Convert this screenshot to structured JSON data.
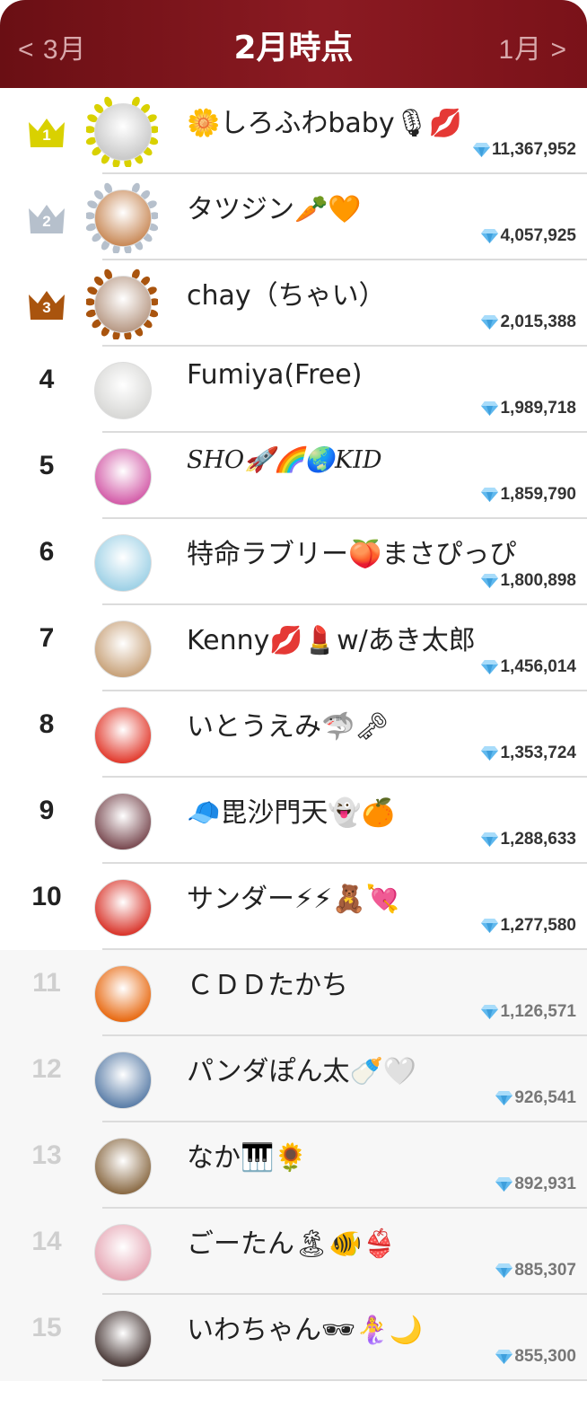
{
  "header": {
    "prev_label": "< 3月",
    "title": "2月時点",
    "next_label": "1月 >",
    "bg_color": "#7a1219"
  },
  "colors": {
    "gold": "#d9d100",
    "silver": "#b6c0cc",
    "bronze": "#a9540e"
  },
  "ranking": [
    {
      "rank": "1",
      "name": "🌼しろふわbaby🎙💋",
      "score": "11,367,952",
      "crown": "gold",
      "avatar_color": "#c9c9c9"
    },
    {
      "rank": "2",
      "name": "タツジン🥕🧡",
      "score": "4,057,925",
      "crown": "silver",
      "avatar_color": "#c98a58"
    },
    {
      "rank": "3",
      "name": "chay（ちゃい）",
      "score": "2,015,388",
      "crown": "bronze",
      "avatar_color": "#b89a86"
    },
    {
      "rank": "4",
      "name": "Fumiya(Free)",
      "score": "1,989,718",
      "crown": "",
      "avatar_color": "#d8d8d6"
    },
    {
      "rank": "5",
      "name": "SHO🚀🌈🌏KID",
      "score": "1,859,790",
      "crown": "",
      "avatar_color": "#d35ca8",
      "style": "serif-italic"
    },
    {
      "rank": "6",
      "name": "特命ラブリー🍑まさぴっぴ",
      "score": "1,800,898",
      "crown": "",
      "avatar_color": "#9ed1e6"
    },
    {
      "rank": "7",
      "name": "Kenny💋💄w/あき太郎",
      "score": "1,456,014",
      "crown": "",
      "avatar_color": "#c8a27a"
    },
    {
      "rank": "8",
      "name": "いとうえみ🦈🗝",
      "score": "1,353,724",
      "crown": "",
      "avatar_color": "#e23b2e"
    },
    {
      "rank": "9",
      "name": "🧢毘沙門天👻🍊",
      "score": "1,288,633",
      "crown": "",
      "avatar_color": "#7a4b52"
    },
    {
      "rank": "10",
      "name": "サンダー⚡⚡🧸💘",
      "score": "1,277,580",
      "crown": "",
      "avatar_color": "#d9352b"
    },
    {
      "rank": "11",
      "name": "ＣＤＤたかち",
      "score": "1,126,571",
      "crown": "",
      "avatar_color": "#e86a12"
    },
    {
      "rank": "12",
      "name": "パンダぽん太🍼🤍",
      "score": "926,541",
      "crown": "",
      "avatar_color": "#5b7ea8"
    },
    {
      "rank": "13",
      "name": "なか🎹🌻",
      "score": "892,931",
      "crown": "",
      "avatar_color": "#8a6a44"
    },
    {
      "rank": "14",
      "name": "ごーたん🏝🐠👙",
      "score": "885,307",
      "crown": "",
      "avatar_color": "#e6a6b4"
    },
    {
      "rank": "15",
      "name": "いわちゃん🕶🧜‍♀️🌙",
      "score": "855,300",
      "crown": "",
      "avatar_color": "#4a3a38"
    }
  ]
}
